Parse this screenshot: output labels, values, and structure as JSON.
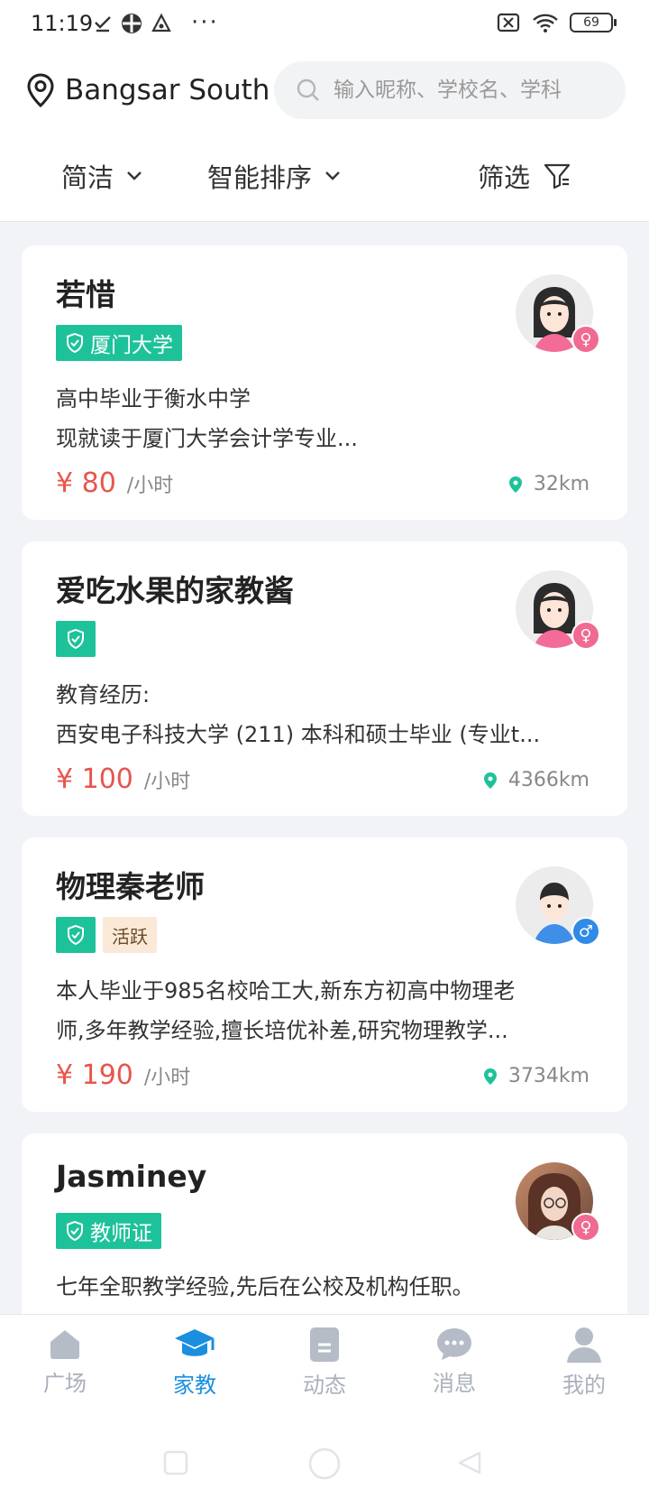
{
  "status_bar": {
    "time": "11:19",
    "battery": "69"
  },
  "header": {
    "location": "Bangsar South",
    "search_placeholder": "输入昵称、学校名、学科",
    "filters": {
      "style": "简洁",
      "sort": "智能排序",
      "filter": "筛选"
    }
  },
  "tutors": [
    {
      "name": "若惜",
      "badge": "厦门大学",
      "desc_line1": "高中毕业于衡水中学",
      "desc_line2": "现就读于厦门大学会计学专业...",
      "price": "¥ 80",
      "unit": "/小时",
      "distance": "32km",
      "gender": "female"
    },
    {
      "name": "爱吃水果的家教酱",
      "desc_line1": "教育经历:",
      "desc_line2": "西安电子科技大学 (211) 本科和硕士毕业 (专业t...",
      "price": "¥ 100",
      "unit": "/小时",
      "distance": "4366km",
      "gender": "female"
    },
    {
      "name": "物理秦老师",
      "active_tag": "活跃",
      "desc_line1": "本人毕业于985名校哈工大,新东方初高中物理老",
      "desc_line2": "师,多年教学经验,擅长培优补差,研究物理教学...",
      "price": "¥ 190",
      "unit": "/小时",
      "distance": "3734km",
      "gender": "male"
    },
    {
      "name": "Jasminey",
      "badge": "教师证",
      "desc_line1": "七年全职教学经验,先后在公校及机构任职。",
      "gender": "female"
    }
  ],
  "tabbar": {
    "items": [
      {
        "label": "广场",
        "icon": "home-icon"
      },
      {
        "label": "家教",
        "icon": "graduation-cap-icon",
        "active": true
      },
      {
        "label": "动态",
        "icon": "document-icon"
      },
      {
        "label": "消息",
        "icon": "chat-icon"
      },
      {
        "label": "我的",
        "icon": "user-icon"
      }
    ]
  },
  "colors": {
    "accent": "#1a8fe0",
    "badge": "#1ec29a",
    "price": "#e8554d"
  }
}
